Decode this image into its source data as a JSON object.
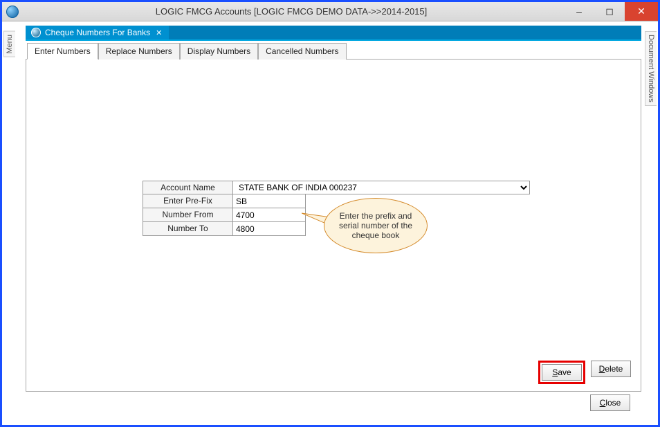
{
  "window": {
    "title": "LOGIC FMCG Accounts  [LOGIC FMCG DEMO DATA->>2014-2015]",
    "minimize": "–",
    "maximize": "◻",
    "close": "✕"
  },
  "side": {
    "left_label": "Menu",
    "right_label": "Document Windows"
  },
  "docTab": {
    "title": "Cheque Numbers For Banks",
    "close": "✕"
  },
  "tabs": {
    "enter": "Enter Numbers",
    "replace": "Replace Numbers",
    "display": "Display Numbers",
    "cancelled": "Cancelled Numbers"
  },
  "form": {
    "account_label": "Account Name",
    "account_value": "STATE BANK OF INDIA 000237",
    "prefix_label": "Enter Pre-Fix",
    "prefix_value": "SB",
    "from_label": "Number From",
    "from_value": "4700",
    "to_label": "Number To",
    "to_value": "4800"
  },
  "callout": {
    "text": "Enter the prefix and serial number of the cheque book"
  },
  "buttons": {
    "save": "Save",
    "delete": "Delete",
    "close": "Close"
  }
}
